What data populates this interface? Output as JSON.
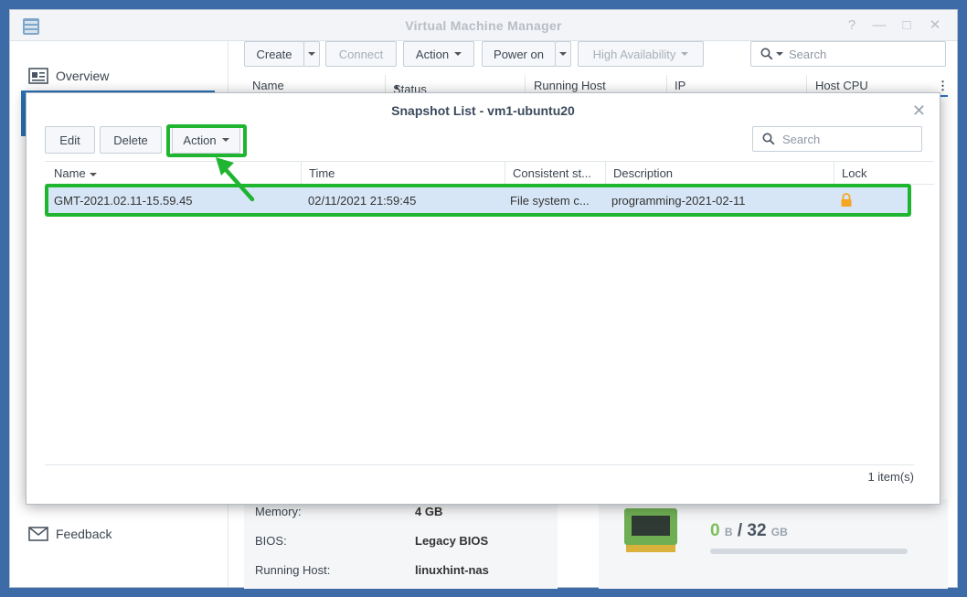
{
  "window": {
    "title": "Virtual Machine Manager"
  },
  "sidebar": {
    "items": [
      {
        "label": "Overview",
        "icon": "overview-icon"
      },
      {
        "label": "Feedback",
        "icon": "feedback-icon"
      }
    ]
  },
  "toolbar": {
    "create_label": "Create",
    "connect_label": "Connect",
    "action_label": "Action",
    "power_on_label": "Power on",
    "high_availability_label": "High Availability",
    "search_placeholder": "Search"
  },
  "vm_grid": {
    "columns": [
      "Name",
      "Status",
      "Running Host",
      "IP",
      "Host CPU"
    ]
  },
  "details": {
    "memory_label": "Memory:",
    "memory_value": "4 GB",
    "bios_label": "BIOS:",
    "bios_value": "Legacy BIOS",
    "running_host_label": "Running Host:",
    "running_host_value": "linuxhint-nas"
  },
  "host_memory": {
    "used": "0",
    "used_unit": "B",
    "separator": "/",
    "total": "32",
    "total_unit": "GB"
  },
  "snapshot_dialog": {
    "title": "Snapshot List - vm1-ubuntu20",
    "edit_label": "Edit",
    "delete_label": "Delete",
    "action_label": "Action",
    "search_placeholder": "Search",
    "columns": [
      "Name",
      "Time",
      "Consistent st...",
      "Description",
      "Lock"
    ],
    "rows": [
      {
        "name": "GMT-2021.02.11-15.59.45",
        "time": "02/11/2021 21:59:45",
        "consistent": "File system c...",
        "description": "programming-2021-02-11",
        "lock": "lock-icon"
      }
    ],
    "count": "1 item(s)"
  },
  "colors": {
    "highlight": "#1fb530",
    "selection": "#d7e6f6",
    "accent": "#2a72b8",
    "lock": "#f5a623"
  }
}
